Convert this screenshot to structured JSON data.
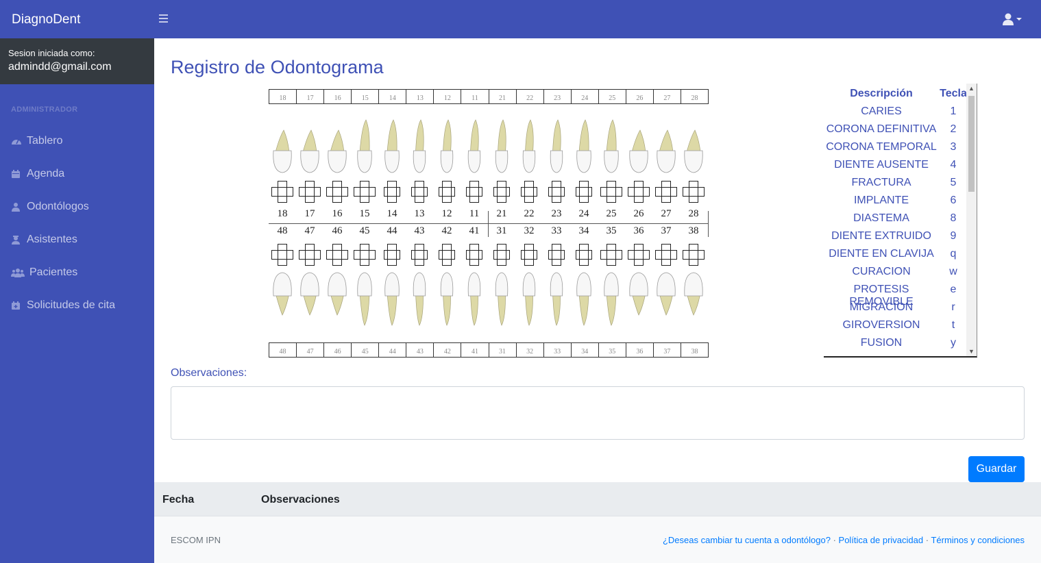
{
  "app": {
    "brand": "DiagnoDent"
  },
  "session": {
    "label": "Sesion iniciada como:",
    "email": "admindd@gmail.com"
  },
  "sidebar": {
    "section": "ADMINISTRADOR",
    "items": [
      {
        "label": "Tablero",
        "icon": "dashboard-icon"
      },
      {
        "label": "Agenda",
        "icon": "calendar-icon"
      },
      {
        "label": "Odontólogos",
        "icon": "user-md-icon"
      },
      {
        "label": "Asistentes",
        "icon": "user-nurse-icon"
      },
      {
        "label": "Pacientes",
        "icon": "users-icon"
      },
      {
        "label": "Solicitudes de cita",
        "icon": "calendar-plus-icon"
      }
    ]
  },
  "page": {
    "title": "Registro de Odontograma"
  },
  "odontogram": {
    "upper_strip": [
      "18",
      "17",
      "16",
      "15",
      "14",
      "13",
      "12",
      "11",
      "21",
      "22",
      "23",
      "24",
      "25",
      "26",
      "27",
      "28"
    ],
    "upper_numbers": [
      "18",
      "17",
      "16",
      "15",
      "14",
      "13",
      "12",
      "11",
      "21",
      "22",
      "23",
      "24",
      "25",
      "26",
      "27",
      "28"
    ],
    "lower_numbers": [
      "48",
      "47",
      "46",
      "45",
      "44",
      "43",
      "42",
      "41",
      "31",
      "32",
      "33",
      "34",
      "35",
      "36",
      "37",
      "38"
    ],
    "lower_strip": [
      "48",
      "47",
      "46",
      "45",
      "44",
      "43",
      "42",
      "41",
      "31",
      "32",
      "33",
      "34",
      "35",
      "36",
      "37",
      "38"
    ]
  },
  "legend": {
    "header_desc": "Descripción",
    "header_key": "Tecla",
    "rows": [
      {
        "desc": "CARIES",
        "key": "1"
      },
      {
        "desc": "CORONA DEFINITIVA",
        "key": "2"
      },
      {
        "desc": "CORONA TEMPORAL",
        "key": "3"
      },
      {
        "desc": "DIENTE AUSENTE",
        "key": "4"
      },
      {
        "desc": "FRACTURA",
        "key": "5"
      },
      {
        "desc": "IMPLANTE",
        "key": "6"
      },
      {
        "desc": "DIASTEMA",
        "key": "8"
      },
      {
        "desc": "DIENTE EXTRUIDO",
        "key": "9"
      },
      {
        "desc": "DIENTE EN CLAVIJA",
        "key": "q"
      },
      {
        "desc": "CURACION",
        "key": "w"
      },
      {
        "desc": "PROTESIS REMOVIBLE",
        "key": "e"
      },
      {
        "desc": "MIGRACION",
        "key": "r"
      },
      {
        "desc": "GIROVERSION",
        "key": "t"
      },
      {
        "desc": "FUSION",
        "key": "y"
      }
    ]
  },
  "form": {
    "obs_label": "Observaciones:",
    "obs_value": "",
    "save_label": "Guardar"
  },
  "history_table": {
    "columns": [
      "Fecha",
      "Observaciones"
    ]
  },
  "footer": {
    "left": "ESCOM IPN",
    "links": [
      "¿Deseas cambiar tu cuenta a odontólogo?",
      "Política de privacidad",
      "Términos y condiciones"
    ],
    "separator": " · "
  },
  "colors": {
    "primary": "#3f51b5",
    "sidebar_session": "#343a40",
    "button": "#007bff"
  }
}
